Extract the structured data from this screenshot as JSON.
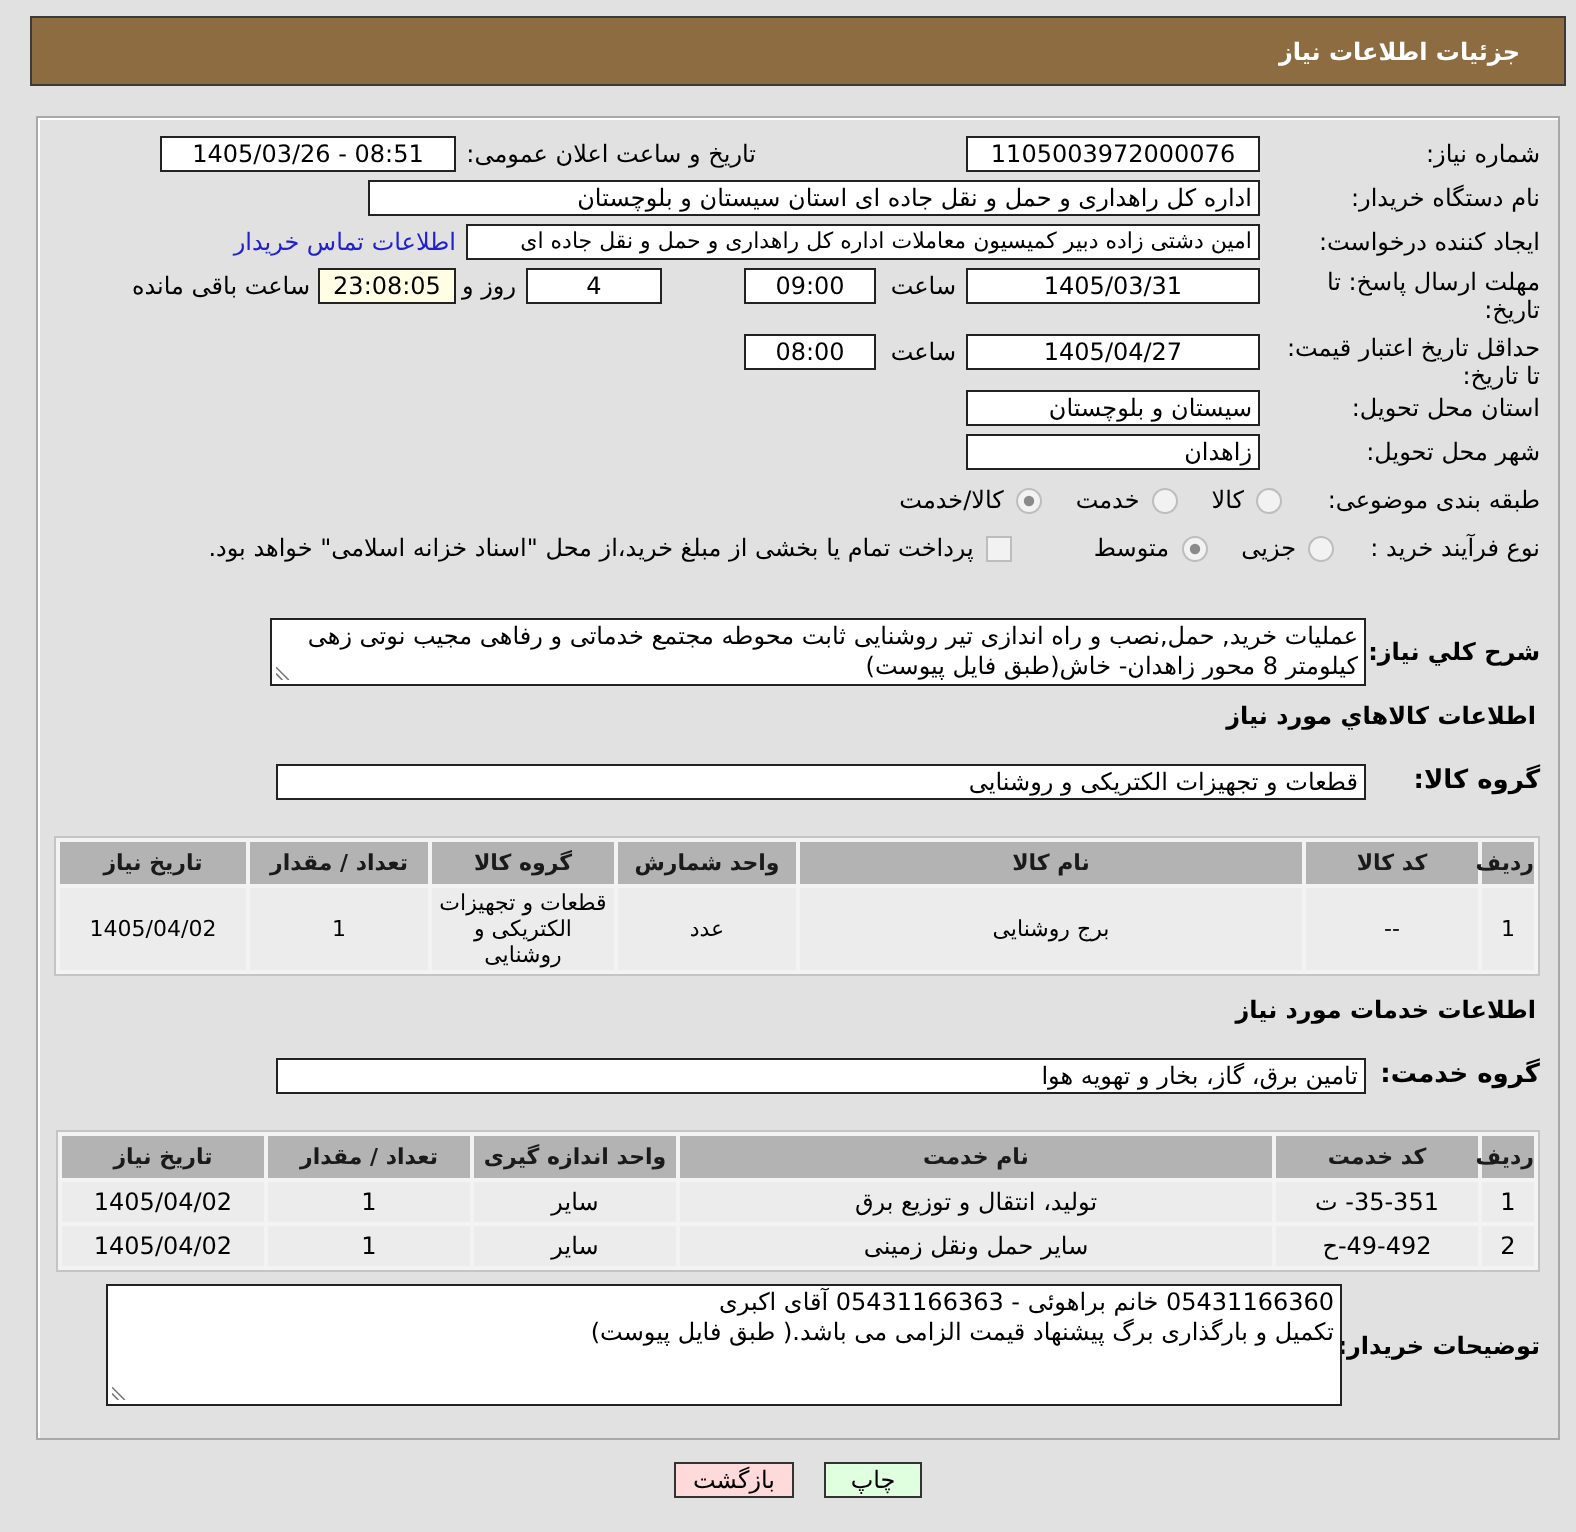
{
  "header": {
    "title": "جزئیات اطلاعات نیاز"
  },
  "need_number": {
    "label": "شماره نیاز:",
    "value": "1105003972000076"
  },
  "announcement": {
    "label": "تاریخ و ساعت اعلان عمومی:",
    "value": "1405/03/26 - 08:51"
  },
  "buyer_org": {
    "label": "نام دستگاه خریدار:",
    "value": "اداره کل راهداری و حمل و نقل جاده ای استان سیستان و بلوچستان"
  },
  "requester": {
    "label": "ایجاد کننده درخواست:",
    "value": "امین دشتی زاده دبیر کمیسیون معاملات اداره کل راهداری و حمل و نقل جاده ای",
    "link": "اطلاعات تماس خریدار"
  },
  "reply_deadline": {
    "label": "مهلت ارسال پاسخ: تا تاریخ:",
    "date": "1405/03/31",
    "time_label": "ساعت",
    "time": "09:00",
    "days": "4",
    "days_label": "روز و",
    "remaining": "23:08:05",
    "remaining_label": "ساعت باقی مانده"
  },
  "price_validity": {
    "label": "حداقل تاریخ اعتبار قیمت: تا تاریخ:",
    "date": "1405/04/27",
    "time_label": "ساعت",
    "time": "08:00"
  },
  "delivery_province": {
    "label": "استان محل تحویل:",
    "value": "سیستان و بلوچستان"
  },
  "delivery_city": {
    "label": "شهر محل تحویل:",
    "value": "زاهدان"
  },
  "classification": {
    "label": "طبقه بندی موضوعی:",
    "disabled": true,
    "options": [
      {
        "label": "کالا",
        "selected": false
      },
      {
        "label": "خدمت",
        "selected": false
      },
      {
        "label": "کالا/خدمت",
        "selected": true
      }
    ]
  },
  "purchase_type": {
    "label": "نوع فرآیند خرید :",
    "disabled": true,
    "options": [
      {
        "label": "جزیی",
        "selected": false
      },
      {
        "label": "متوسط",
        "selected": true
      }
    ],
    "treasury": {
      "label": "پرداخت تمام یا بخشی از مبلغ خرید،از محل \"اسناد خزانه اسلامی\" خواهد بود.",
      "checked": false
    }
  },
  "description": {
    "label": "شرح كلي نياز:",
    "value": "عملیات خرید, حمل,نصب و راه اندازی تیر روشنایی ثابت محوطه مجتمع خدماتی و رفاهی مجیب نوتی زهی کیلومتر 8 محور زاهدان- خاش(طبق فایل پیوست)"
  },
  "goods": {
    "heading": "اطلاعات كالاهاي مورد نياز",
    "group_label": "گروه کالا:",
    "group": "قطعات و تجهیزات الکتریکی و روشنایی",
    "table": {
      "columns": [
        "ردیف",
        "کد کالا",
        "نام کالا",
        "واحد شمارش",
        "گروه کالا",
        "تعداد / مقدار",
        "تاریخ نیاز"
      ],
      "rows": [
        [
          "1",
          "--",
          "برج روشنایی",
          "عدد",
          "قطعات و تجهیزات الکتریکی و روشنایی",
          "1",
          "1405/04/02"
        ]
      ]
    }
  },
  "services": {
    "heading": "اطلاعات خدمات مورد نیاز",
    "group_label": "گروه خدمت:",
    "group": "تامین برق، گاز، بخار و تهویه هوا",
    "table": {
      "columns": [
        "ردیف",
        "کد خدمت",
        "نام خدمت",
        "واحد اندازه گیری",
        "تعداد / مقدار",
        "تاریخ نیاز"
      ],
      "rows": [
        [
          "1",
          "ت -35-351",
          "تولید، انتقال و توزیع برق",
          "سایر",
          "1",
          "1405/04/02"
        ],
        [
          "2",
          "ح-49-492",
          "سایر حمل ونقل زمینی",
          "سایر",
          "1",
          "1405/04/02"
        ]
      ]
    }
  },
  "buyer_notes": {
    "label": "توضیحات خریدار:",
    "value": "05431166360 خانم براهوئی - 05431166363 آقای اکبری\nتکمیل و بارگذاری برگ پیشنهاد قیمت الزامی می باشد.( طبق فایل پیوست)"
  },
  "buttons": [
    {
      "label": "چاپ",
      "kind": "print"
    },
    {
      "label": "بازگشت",
      "kind": "back"
    }
  ]
}
